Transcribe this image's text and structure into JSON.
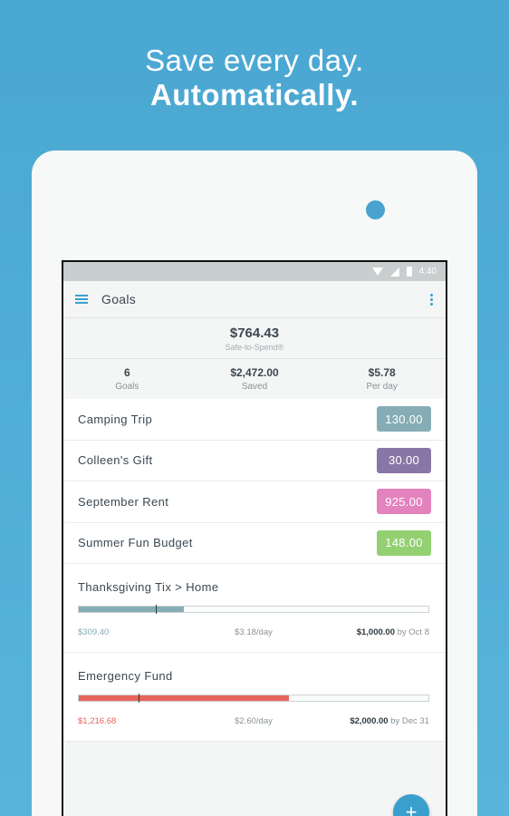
{
  "headline": {
    "line1": "Save every day.",
    "line2": "Automatically."
  },
  "status": {
    "time": "4:40"
  },
  "appbar": {
    "title": "Goals"
  },
  "safe": {
    "amount": "$764.43",
    "label": "Safe-to-Spend®"
  },
  "stats": [
    {
      "value": "6",
      "label": "Goals"
    },
    {
      "value": "$2,472.00",
      "label": "Saved"
    },
    {
      "value": "$5.78",
      "label": "Per day"
    }
  ],
  "rows": [
    {
      "name": "Camping Trip",
      "amount": "130.00",
      "color": "#86adb5"
    },
    {
      "name": "Colleen's Gift",
      "amount": "30.00",
      "color": "#8a76a6"
    },
    {
      "name": "September Rent",
      "amount": "925.00",
      "color": "#e383be"
    },
    {
      "name": "Summer Fun Budget",
      "amount": "148.00",
      "color": "#93d072"
    }
  ],
  "goals": [
    {
      "name": "Thanksgiving Tix > Home",
      "saved": "$309.40",
      "rate": "$3.18/day",
      "target": "$1,000.00",
      "by": "by Oct 8",
      "progress": 0.3,
      "marker": 0.22,
      "color": "#86adb5"
    },
    {
      "name": "Emergency Fund",
      "saved": "$1,216.68",
      "rate": "$2.60/day",
      "target": "$2,000.00",
      "by": "by Dec 31",
      "progress": 0.6,
      "marker": 0.17,
      "color": "#e6645a"
    }
  ],
  "fab": {
    "label": "+"
  }
}
